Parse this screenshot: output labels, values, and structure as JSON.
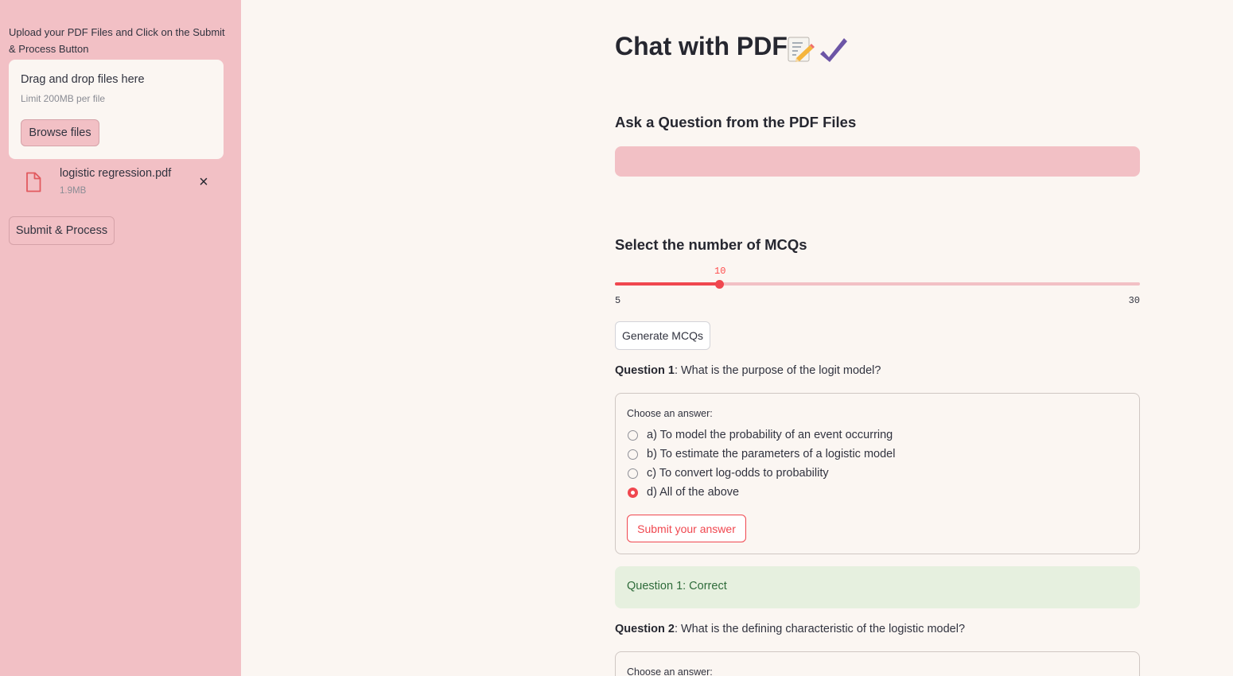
{
  "sidebar": {
    "upload_label": "Upload your PDF Files and Click on the Submit & Process Button",
    "dropzone": {
      "title": "Drag and drop files here",
      "limit": "Limit 200MB per file",
      "browse_label": "Browse files"
    },
    "file": {
      "name": "logistic regression.pdf",
      "size": "1.9MB",
      "icon": "file-icon",
      "remove_icon": "×"
    },
    "submit_label": "Submit & Process"
  },
  "main": {
    "title": "Chat with PDF",
    "title_icons": [
      "memo-icon",
      "check-mark-icon"
    ],
    "ask_heading": "Ask a Question from the PDF Files",
    "question_input": {
      "value": "",
      "placeholder": ""
    },
    "mcq_heading": "Select the number of MCQs",
    "slider": {
      "min": 5,
      "max": 30,
      "value": 10,
      "min_label": "5",
      "max_label": "30",
      "value_label": "10"
    },
    "generate_label": "Generate MCQs",
    "questions": [
      {
        "prefix": "Question 1",
        "text": ": What is the purpose of the logit model?",
        "choose_label": "Choose an answer:",
        "options": [
          "a) To model the probability of an event occurring",
          "b) To estimate the parameters of a logistic model",
          "c) To convert log-odds to probability",
          "d) All of the above"
        ],
        "selected_index": 3,
        "submit_label": "Submit your answer"
      },
      {
        "prefix": "Question 2",
        "text": ": What is the defining characteristic of the logistic model?",
        "choose_label": "Choose an answer:"
      }
    ],
    "result": "Question 1: Correct"
  },
  "colors": {
    "sidebar_bg": "#f2c0c5",
    "main_bg": "#fbf6f2",
    "accent": "#f0474f",
    "success_bg": "#e6f0df",
    "success_text": "#2e6b3a"
  }
}
